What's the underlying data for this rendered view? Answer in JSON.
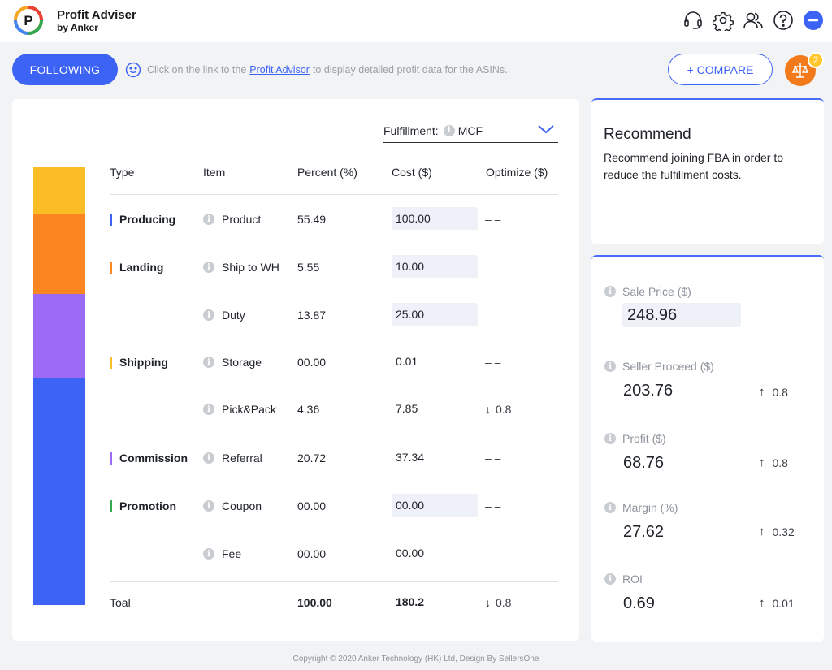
{
  "app": {
    "title": "Profit Adviser",
    "subtitle": "by Anker"
  },
  "header_icons": [
    "headset-icon",
    "gear-icon",
    "users-icon",
    "help-icon",
    "minimize-icon"
  ],
  "toolbar": {
    "following_label": "FOLLOWING",
    "hint_prefix": "Click on the link to the",
    "hint_link": "Profit Advisor",
    "hint_suffix": "to display detailed profit data for the ASINs.",
    "compare_label": "+ COMPARE",
    "compare_count": "2"
  },
  "fulfillment": {
    "label": "Fulfillment:",
    "value": "MCF"
  },
  "table": {
    "headers": {
      "type": "Type",
      "item": "Item",
      "percent": "Percent (%)",
      "cost": "Cost ($)",
      "optimize": "Optimize ($)"
    },
    "rows": [
      {
        "type": "Producing",
        "item": "Product",
        "percent": "55.49",
        "cost": "100.00",
        "optimize": "– –"
      },
      {
        "type": "Landing",
        "item": "Ship to WH",
        "percent": "5.55",
        "cost": "10.00",
        "optimize": ""
      },
      {
        "type": "",
        "item": "Duty",
        "percent": "13.87",
        "cost": "25.00",
        "optimize": ""
      },
      {
        "type": "Shipping",
        "item": "Storage",
        "percent": "00.00",
        "cost": "0.01",
        "optimize": "– –"
      },
      {
        "type": "",
        "item": "Pick&Pack",
        "percent": "4.36",
        "cost": "7.85",
        "optimize": "0.8"
      },
      {
        "type": "Commission",
        "item": "Referral",
        "percent": "20.72",
        "cost": "37.34",
        "optimize": "– –"
      },
      {
        "type": "Promotion",
        "item": "Coupon",
        "percent": "00.00",
        "cost": "00.00",
        "optimize": "– –"
      },
      {
        "type": "",
        "item": "Fee",
        "percent": "00.00",
        "cost": "00.00",
        "optimize": "– –"
      }
    ],
    "total": {
      "label": "Toal",
      "percent": "100.00",
      "cost": "180.2",
      "optimize": "0.8"
    }
  },
  "category_colors": {
    "producing": "#fbbd26",
    "landing": "#fa8521",
    "shipping": "#9c6bf6",
    "commission": "#3d63f5",
    "promotion": "#35a853"
  },
  "recommend": {
    "title": "Recommend",
    "text": "Recommend joining FBA in order to reduce the fulfillment costs."
  },
  "metrics": {
    "sale_price": {
      "label": "Sale Price ($)",
      "value": "248.96"
    },
    "seller_proceed": {
      "label": "Seller Proceed ($)",
      "value": "203.76",
      "delta": "0.8"
    },
    "profit": {
      "label": "Profit ($)",
      "value": "68.76",
      "delta": "0.8"
    },
    "margin": {
      "label": "Margin (%)",
      "value": "27.62",
      "delta": "0.32"
    },
    "roi": {
      "label": "ROI",
      "value": "0.69",
      "delta": "0.01"
    }
  },
  "footer": {
    "text": "Copyright © 2020 Anker Technology (HK) Ltd, Design By SellersOne"
  }
}
